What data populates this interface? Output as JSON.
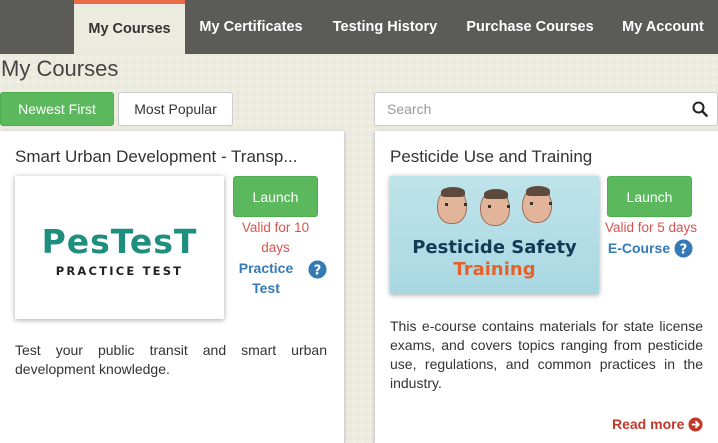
{
  "nav": {
    "items": [
      {
        "label": "My Courses",
        "active": true
      },
      {
        "label": "My Certificates"
      },
      {
        "label": "Testing History"
      },
      {
        "label": "Purchase Courses"
      },
      {
        "label": "My Account"
      }
    ]
  },
  "page": {
    "title": "My Courses"
  },
  "filters": {
    "newest_label": "Newest First",
    "popular_label": "Most Popular",
    "active": "Newest First"
  },
  "search": {
    "placeholder": "Search",
    "value": ""
  },
  "courses": [
    {
      "title": "Smart Urban Development - Transp...",
      "thumbnail": {
        "brand": "PesTesT",
        "tagline": "PRACTICE TEST"
      },
      "launch_label": "Launch",
      "validity": "Valid for 10 days",
      "type": "Practice Test",
      "help_icon": "question-circle-icon",
      "description": "Test your public transit and smart urban development knowledge."
    },
    {
      "title": "Pesticide Use and Training",
      "thumbnail": {
        "line1": "Pesticide Safety",
        "line2": "Training"
      },
      "launch_label": "Launch",
      "validity": "Valid for 5 days",
      "type": "E-Course",
      "help_icon": "question-circle-icon",
      "description": "This e-course contains materials for state license exams, and covers topics ranging from pesticide use, regulations, and common practices in the industry.",
      "read_more_label": "Read more"
    }
  ],
  "colors": {
    "nav_bg": "#5b5b58",
    "nav_active_accent": "#ec6b47",
    "success": "#5cb85c",
    "validity_red": "#d9534f",
    "link_blue": "#337ab7",
    "brand_teal": "#1e8e7e"
  }
}
